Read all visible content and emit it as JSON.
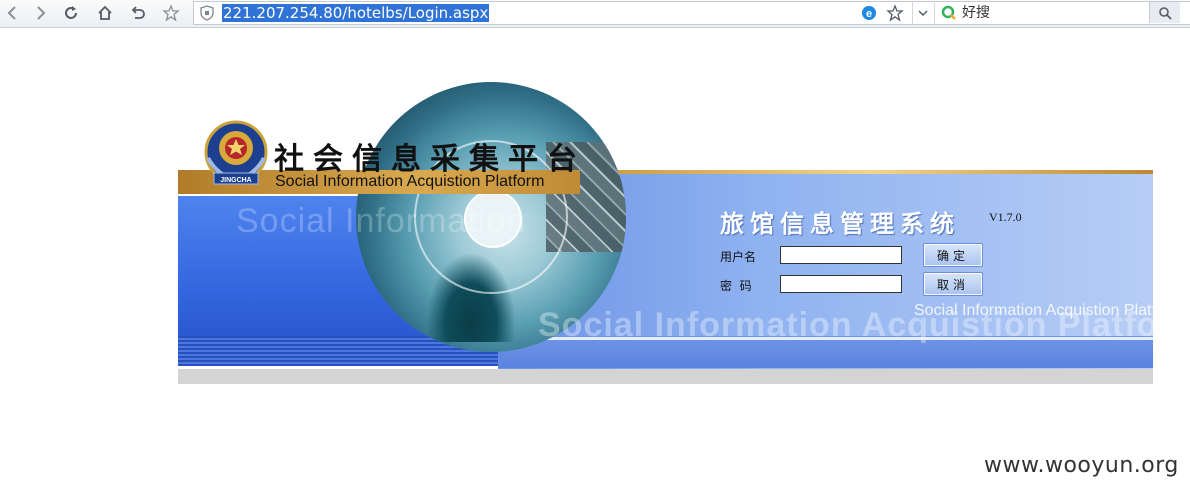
{
  "browser": {
    "url": "221.207.254.80/hotelbs/Login.aspx",
    "search_engine_label": "好搜",
    "icons": [
      "back-icon",
      "forward-icon",
      "reload-icon",
      "home-icon",
      "undo-icon",
      "star-icon",
      "shield-icon",
      "ie-icon",
      "favorite-icon",
      "dropdown-icon",
      "search-logo-icon",
      "search-icon"
    ]
  },
  "banner": {
    "platform_title": "社会信息采集平台",
    "platform_subtitle": "Social Information Acquistion Platform",
    "watermark_left": "Social Information",
    "watermark_bottom": "Social Information Acquistion Platform",
    "watermark_small": "Social Information Acquistion Platform",
    "emblem_text": "JINGCHA"
  },
  "login": {
    "system_title": "旅馆信息管理系统",
    "version": "V1.7.0",
    "username_label": "用户名",
    "password_label": "密  码",
    "username_value": "",
    "password_value": "",
    "ok_button": "确定",
    "cancel_button": "取消"
  },
  "footer": {
    "site_watermark": "www.wooyun.org"
  }
}
